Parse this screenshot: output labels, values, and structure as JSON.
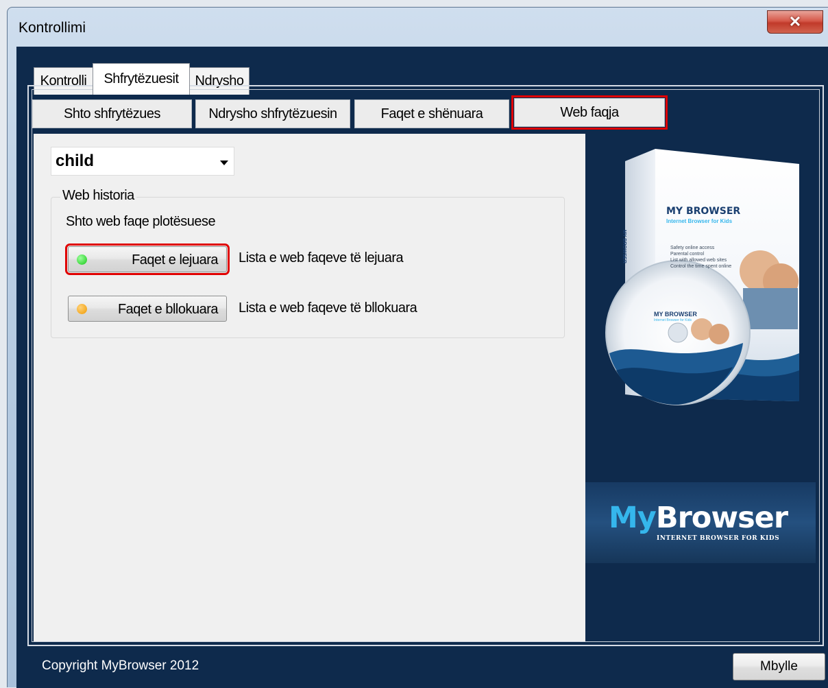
{
  "window": {
    "title": "Kontrollimi",
    "close_glyph": "✕"
  },
  "main_tabs": [
    {
      "label": "Kontrolli",
      "active": false
    },
    {
      "label": "Shfrytëzuesit",
      "active": true
    },
    {
      "label": "Ndrysho",
      "active": false
    }
  ],
  "sub_tabs": [
    {
      "label": "Shto shfrytëzues"
    },
    {
      "label": "Ndrysho shfrytëzuesin"
    },
    {
      "label": "Faqet e shënuara"
    },
    {
      "label": "Web faqja",
      "highlighted": true
    }
  ],
  "user_select": {
    "value": "child"
  },
  "group": {
    "title": "Web historia",
    "heading": "Shto web faqe plotësuese",
    "allowed": {
      "button_label": "Faqet e lejuara",
      "description": "Lista e web faqeve të lejuara",
      "indicator_color": "#22dd22",
      "highlighted": true
    },
    "blocked": {
      "button_label": "Faqet e bllokuara",
      "description": "Lista e web faqeve të bllokuara",
      "indicator_color": "#f5a300"
    }
  },
  "banner": {
    "box_title": "MY BROWSER",
    "box_subtitle": "Internet Browser for Kids",
    "box_side": "MY BROWSER",
    "features": [
      "Safety online access",
      "Parental control",
      "List with allowed web sites",
      "Control the time spent online"
    ],
    "cd_title": "MY BROWSER",
    "cd_subtitle": "Internet Browser for Kids",
    "logo_my": "My",
    "logo_browser": "Browser",
    "logo_tagline": "INTERNET BROWSER FOR KIDS",
    "colors": {
      "logo_my": "#35b6ec",
      "logo_browser": "#ffffff",
      "background": "#0e2a4c"
    }
  },
  "footer": {
    "copyright": "Copyright MyBrowser 2012",
    "close_button": "Mbylle"
  }
}
